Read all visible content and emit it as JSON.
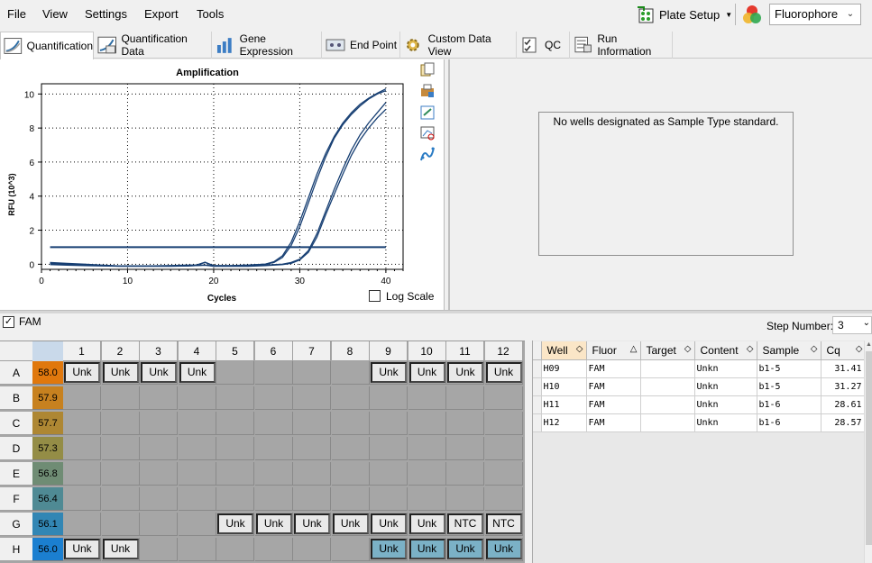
{
  "menu": [
    "File",
    "View",
    "Settings",
    "Export",
    "Tools"
  ],
  "toolbar": {
    "plate_setup": "Plate Setup",
    "fluorophore": "Fluorophore"
  },
  "tabs": [
    "Quantification",
    "Quantification Data",
    "Gene Expression",
    "End Point",
    "Custom Data View",
    "QC",
    "Run Information"
  ],
  "chart": {
    "title": "Amplification",
    "ylabel": "RFU (10^3)",
    "xlabel": "Cycles",
    "log_scale_label": "Log Scale"
  },
  "chart_data": {
    "type": "line",
    "title": "Amplification",
    "xlabel": "Cycles",
    "ylabel": "RFU (10^3)",
    "xlim": [
      0,
      42
    ],
    "ylim": [
      -0.3,
      10.6
    ],
    "xticks": [
      0,
      10,
      20,
      30,
      40
    ],
    "yticks": [
      0,
      2,
      4,
      6,
      8,
      10
    ],
    "grid": true,
    "threshold": 1.0,
    "series": [
      {
        "x": [
          1,
          3,
          5,
          7,
          9,
          11,
          13,
          15,
          17,
          18,
          19,
          20,
          22,
          24,
          26,
          27,
          28,
          29,
          30,
          31,
          32,
          33,
          34,
          35,
          36,
          37,
          38,
          39,
          40
        ],
        "y": [
          0.1,
          0.05,
          0.0,
          -0.05,
          -0.1,
          -0.1,
          -0.1,
          -0.08,
          -0.05,
          -0.05,
          0.1,
          -0.08,
          -0.08,
          -0.05,
          0.0,
          0.15,
          0.5,
          1.3,
          2.5,
          3.9,
          5.3,
          6.5,
          7.5,
          8.3,
          8.9,
          9.4,
          9.75,
          10.05,
          10.3
        ]
      },
      {
        "x": [
          1,
          3,
          5,
          7,
          9,
          11,
          13,
          15,
          17,
          18,
          19,
          20,
          22,
          24,
          26,
          27,
          28,
          29,
          30,
          31,
          32,
          33,
          34,
          35,
          36,
          37,
          38,
          39,
          40
        ],
        "y": [
          0.05,
          0.0,
          -0.05,
          -0.08,
          -0.1,
          -0.1,
          -0.1,
          -0.1,
          -0.08,
          -0.05,
          0.12,
          -0.1,
          -0.1,
          -0.05,
          0.0,
          0.1,
          0.4,
          1.1,
          2.2,
          3.6,
          5.0,
          6.3,
          7.4,
          8.2,
          8.8,
          9.3,
          9.7,
          10.0,
          10.2
        ]
      },
      {
        "x": [
          1,
          3,
          5,
          7,
          9,
          11,
          13,
          15,
          17,
          19,
          20,
          22,
          24,
          26,
          28,
          29,
          30,
          31,
          32,
          33,
          34,
          35,
          36,
          37,
          38,
          39,
          40
        ],
        "y": [
          0.0,
          -0.02,
          -0.05,
          -0.08,
          -0.1,
          -0.1,
          -0.1,
          -0.1,
          -0.1,
          -0.05,
          -0.1,
          -0.1,
          -0.1,
          -0.05,
          0.0,
          0.1,
          0.3,
          0.8,
          1.8,
          3.1,
          4.4,
          5.6,
          6.7,
          7.6,
          8.3,
          8.9,
          9.5
        ]
      },
      {
        "x": [
          1,
          3,
          5,
          7,
          9,
          11,
          13,
          15,
          17,
          19,
          20,
          22,
          24,
          26,
          28,
          29,
          30,
          31,
          32,
          33,
          34,
          35,
          36,
          37,
          38,
          39,
          40
        ],
        "y": [
          -0.02,
          -0.05,
          -0.08,
          -0.1,
          -0.12,
          -0.12,
          -0.12,
          -0.12,
          -0.1,
          -0.05,
          -0.12,
          -0.12,
          -0.12,
          -0.08,
          -0.02,
          0.05,
          0.25,
          0.7,
          1.6,
          2.9,
          4.1,
          5.3,
          6.4,
          7.3,
          8.0,
          8.6,
          9.1
        ]
      }
    ]
  },
  "standard_curve": {
    "message": "No wells designated as Sample Type standard."
  },
  "fluor_filter": {
    "label": "FAM",
    "checked": true
  },
  "step": {
    "label": "Step Number:",
    "value": "3"
  },
  "plate": {
    "columns": [
      "1",
      "2",
      "3",
      "4",
      "5",
      "6",
      "7",
      "8",
      "9",
      "10",
      "11",
      "12"
    ],
    "rows": [
      {
        "label": "A",
        "temp": "58.0",
        "color": "#e0780d",
        "wells": [
          "Unk",
          "Unk",
          "Unk",
          "Unk",
          "",
          "",
          "",
          "",
          "Unk",
          "Unk",
          "Unk",
          "Unk"
        ],
        "selected": []
      },
      {
        "label": "B",
        "temp": "57.9",
        "color": "#c7811f",
        "wells": [
          "",
          "",
          "",
          "",
          "",
          "",
          "",
          "",
          "",
          "",
          "",
          ""
        ],
        "selected": []
      },
      {
        "label": "C",
        "temp": "57.7",
        "color": "#ae8733",
        "wells": [
          "",
          "",
          "",
          "",
          "",
          "",
          "",
          "",
          "",
          "",
          "",
          ""
        ],
        "selected": []
      },
      {
        "label": "D",
        "temp": "57.3",
        "color": "#948d46",
        "wells": [
          "",
          "",
          "",
          "",
          "",
          "",
          "",
          "",
          "",
          "",
          "",
          ""
        ],
        "selected": []
      },
      {
        "label": "E",
        "temp": "56.8",
        "color": "#6f8c74",
        "wells": [
          "",
          "",
          "",
          "",
          "",
          "",
          "",
          "",
          "",
          "",
          "",
          ""
        ],
        "selected": []
      },
      {
        "label": "F",
        "temp": "56.4",
        "color": "#4f8a94",
        "wells": [
          "",
          "",
          "",
          "",
          "",
          "",
          "",
          "",
          "",
          "",
          "",
          ""
        ],
        "selected": []
      },
      {
        "label": "G",
        "temp": "56.1",
        "color": "#3286b4",
        "wells": [
          "",
          "",
          "",
          "",
          "Unk",
          "Unk",
          "Unk",
          "Unk",
          "Unk",
          "Unk",
          "NTC",
          "NTC"
        ],
        "selected": []
      },
      {
        "label": "H",
        "temp": "56.0",
        "color": "#1b7fd0",
        "wells": [
          "Unk",
          "Unk",
          "",
          "",
          "",
          "",
          "",
          "",
          "Unk",
          "Unk",
          "Unk",
          "Unk"
        ],
        "selected": [
          8,
          9,
          10,
          11
        ]
      }
    ]
  },
  "results_table": {
    "headers": [
      "Well",
      "Fluor",
      "Target",
      "Content",
      "Sample",
      "Cq"
    ],
    "rows": [
      [
        "H09",
        "FAM",
        "",
        "Unkn",
        "b1-5",
        "31.41"
      ],
      [
        "H10",
        "FAM",
        "",
        "Unkn",
        "b1-5",
        "31.27"
      ],
      [
        "H11",
        "FAM",
        "",
        "Unkn",
        "b1-6",
        "28.61"
      ],
      [
        "H12",
        "FAM",
        "",
        "Unkn",
        "b1-6",
        "28.57"
      ]
    ]
  }
}
